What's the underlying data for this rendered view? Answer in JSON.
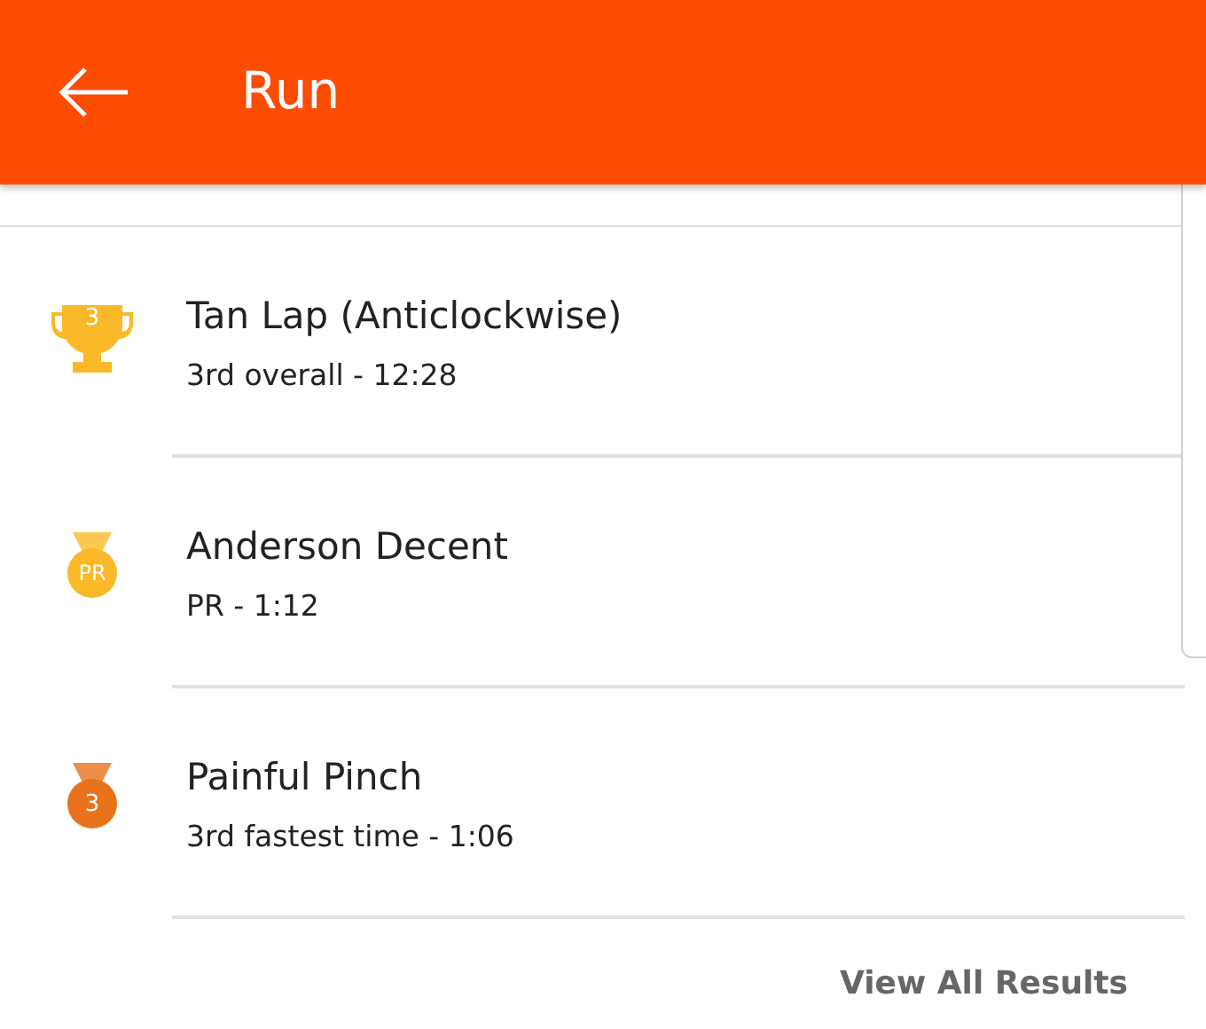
{
  "app_bar": {
    "title": "Run"
  },
  "results": [
    {
      "kind": "trophy",
      "color": "#f9b928",
      "badge": "3",
      "title": "Tan Lap (Anticlockwise)",
      "subtitle": "3rd overall - 12:28"
    },
    {
      "kind": "medal",
      "color": "#f9b928",
      "badge": "PR",
      "title": "Anderson Decent",
      "subtitle": "PR - 1:12"
    },
    {
      "kind": "medal",
      "color": "#e8721c",
      "badge": "3",
      "title": "Painful Pinch",
      "subtitle": "3rd fastest time - 1:06"
    }
  ],
  "footer_link": "View All Results"
}
